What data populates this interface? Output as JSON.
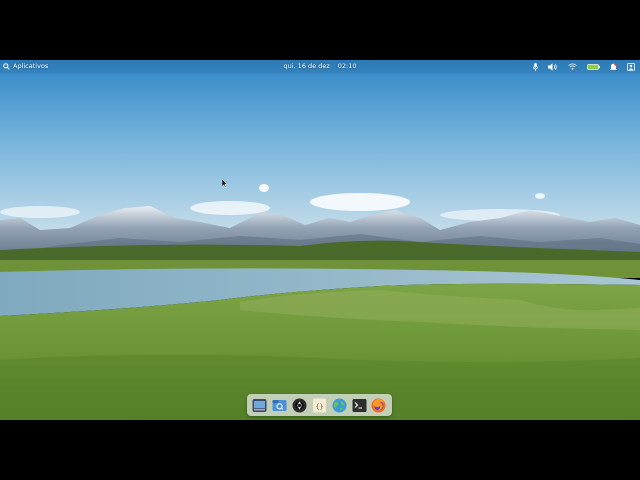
{
  "panel": {
    "apps_label": "Aplicativos",
    "date": "qui, 16 de dez",
    "time": "02:10"
  },
  "indicators": [
    {
      "name": "microphone-icon"
    },
    {
      "name": "volume-icon"
    },
    {
      "name": "network-icon"
    },
    {
      "name": "battery-icon"
    },
    {
      "name": "notifications-icon"
    },
    {
      "name": "session-icon"
    }
  ],
  "dock": {
    "items": [
      {
        "name": "multitasking-view",
        "icon": "desktop-icon"
      },
      {
        "name": "files",
        "icon": "files-icon"
      },
      {
        "name": "camera",
        "icon": "camera-icon"
      },
      {
        "name": "code-editor",
        "icon": "code-icon"
      },
      {
        "name": "browser",
        "icon": "web-browser-icon"
      },
      {
        "name": "terminal",
        "icon": "terminal-icon"
      },
      {
        "name": "firefox",
        "icon": "firefox-icon"
      }
    ]
  },
  "colors": {
    "sky_top": "#2f86c8",
    "sky_bottom": "#d6e6ee",
    "grass": "#6f9a3b",
    "water": "#8fb4c8"
  }
}
